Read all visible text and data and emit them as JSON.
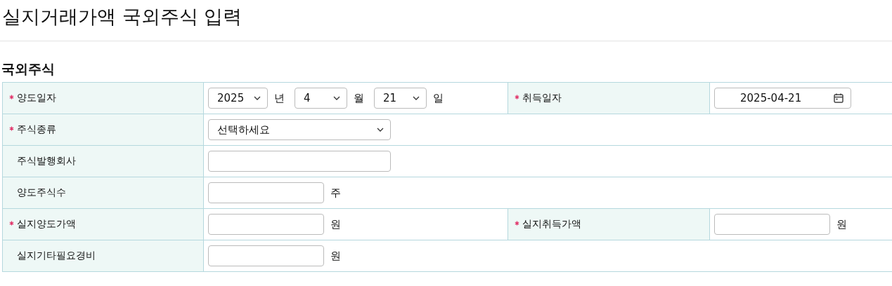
{
  "page_title": "실지거래가액 국외주식 입력",
  "section_title": "국외주식",
  "rows": [
    {
      "fields": [
        {
          "label": "양도일자",
          "required": true,
          "kind": "ymd",
          "parts": [
            {
              "value": "2025",
              "unit": "년"
            },
            {
              "value": "4",
              "unit": "월"
            },
            {
              "value": "21",
              "unit": "일"
            }
          ]
        },
        {
          "label": "취득일자",
          "required": true,
          "kind": "date",
          "value": "2025-04-21"
        }
      ]
    },
    {
      "fields": [
        {
          "label": "주식종류",
          "required": true,
          "kind": "select",
          "value": "선택하세요"
        }
      ]
    },
    {
      "fields": [
        {
          "label": "주식발행회사",
          "required": false,
          "kind": "text"
        }
      ]
    },
    {
      "fields": [
        {
          "label": "양도주식수",
          "required": false,
          "kind": "short",
          "unit": "주"
        }
      ]
    },
    {
      "fields": [
        {
          "label": "실지양도가액",
          "required": true,
          "kind": "short",
          "unit": "원"
        },
        {
          "label": "실지취득가액",
          "required": true,
          "kind": "short",
          "unit": "원"
        }
      ]
    },
    {
      "fields": [
        {
          "label": "실지기타필요경비",
          "required": false,
          "kind": "short",
          "unit": "원"
        }
      ]
    }
  ]
}
